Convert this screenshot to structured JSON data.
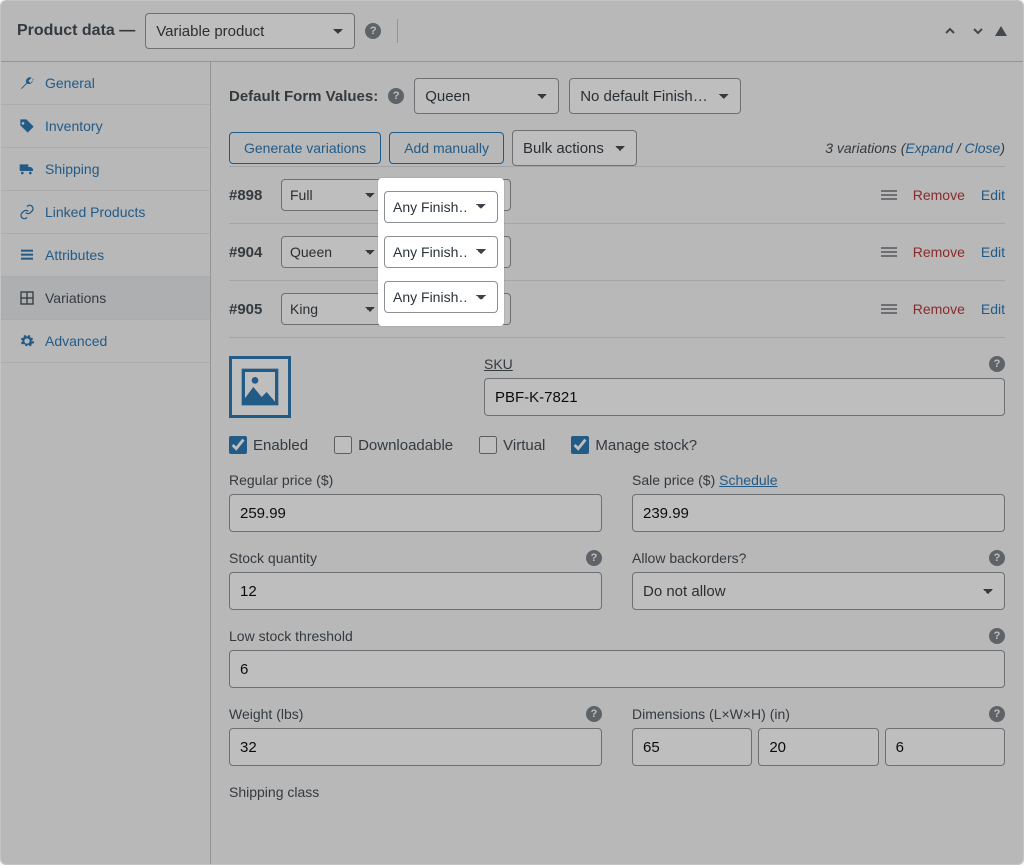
{
  "header": {
    "title": "Product data —",
    "product_type_select": "Variable product"
  },
  "tabs": [
    {
      "label": "General"
    },
    {
      "label": "Inventory"
    },
    {
      "label": "Shipping"
    },
    {
      "label": "Linked Products"
    },
    {
      "label": "Attributes"
    },
    {
      "label": "Variations"
    },
    {
      "label": "Advanced"
    }
  ],
  "default_form": {
    "label": "Default Form Values:",
    "attr1": "Queen",
    "attr2": "No default Finish…"
  },
  "toolbar": {
    "generate": "Generate variations",
    "add_manually": "Add manually",
    "bulk_actions": "Bulk actions",
    "count_text": "3 variations",
    "expand": "Expand",
    "close": "Close"
  },
  "variations": [
    {
      "id": "#898",
      "attr1": "Full",
      "attr2": "Any Finish…",
      "remove": "Remove",
      "edit": "Edit"
    },
    {
      "id": "#904",
      "attr1": "Queen",
      "attr2": "Any Finish…",
      "remove": "Remove",
      "edit": "Edit"
    },
    {
      "id": "#905",
      "attr1": "King",
      "attr2": "Any Finish…",
      "remove": "Remove",
      "edit": "Edit"
    }
  ],
  "detail": {
    "sku_label": "SKU",
    "sku_value": "PBF-K-7821",
    "checkboxes": {
      "enabled": "Enabled",
      "downloadable": "Downloadable",
      "virtual": "Virtual",
      "manage_stock": "Manage stock?"
    },
    "regular_price_label": "Regular price ($)",
    "regular_price_value": "259.99",
    "sale_price_label": "Sale price ($)",
    "schedule_link": "Schedule",
    "sale_price_value": "239.99",
    "stock_qty_label": "Stock quantity",
    "stock_qty_value": "12",
    "backorders_label": "Allow backorders?",
    "backorders_value": "Do not allow",
    "low_stock_label": "Low stock threshold",
    "low_stock_value": "6",
    "weight_label": "Weight (lbs)",
    "weight_value": "32",
    "dimensions_label": "Dimensions (L×W×H) (in)",
    "dim_l": "65",
    "dim_w": "20",
    "dim_h": "6",
    "shipping_class_label": "Shipping class"
  }
}
